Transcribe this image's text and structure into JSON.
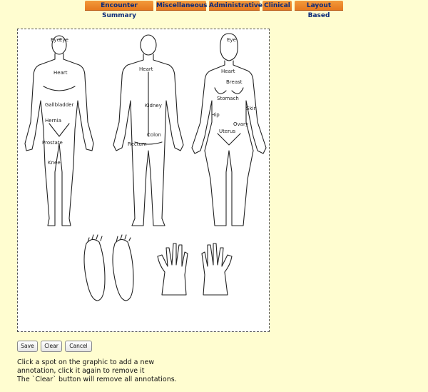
{
  "nav": {
    "tabs": [
      "Encounter Summary",
      "Miscellaneous",
      "Administrative",
      "Clinical",
      "Layout Based"
    ]
  },
  "annotations": {
    "front_male": [
      "Eye",
      "Eye",
      "Heart",
      "Gallbladder",
      "Hernia",
      "Prostate",
      "Knee"
    ],
    "back": [
      "Heart",
      "Kidney",
      "Colon",
      "Rectum"
    ],
    "front_female": [
      "Eye",
      "Heart",
      "Breast",
      "Stomach",
      "Skin",
      "Hip",
      "Ovary",
      "Uterus"
    ]
  },
  "buttons": {
    "save": "Save",
    "clear": "Clear",
    "cancel": "Cancel"
  },
  "instructions": {
    "line1": "Click a spot on the graphic to add a new",
    "line2": "annotation, click it again to remove it",
    "line3": "The `Clear` button will remove all annotations."
  },
  "colors": {
    "background": "#fffdd0",
    "tab": "#ea8526",
    "tab_text": "#0b2a7a"
  }
}
